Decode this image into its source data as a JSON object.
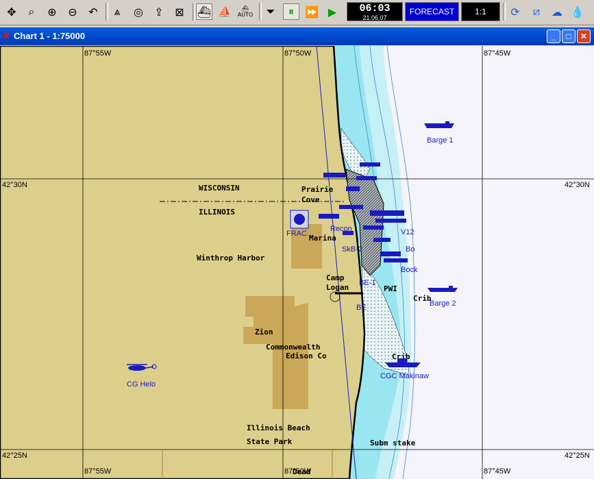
{
  "toolbar": {
    "icons": [
      "zoom-fit-icon",
      "zoom-window-icon",
      "zoom-in-icon",
      "zoom-out-icon",
      "undo-icon",
      "route-icon",
      "target-icon",
      "upload-icon",
      "chart-tool-icon",
      "ship-view-icon",
      "ship-icon",
      "auto-ship-icon",
      "stop-icon",
      "pause-icon",
      "fast-forward-icon",
      "play-icon",
      "satellite-icon",
      "chart-icon",
      "weather-icon",
      "water-drop-icon"
    ],
    "auto_label": "AUTO",
    "clock_time": "06:03",
    "clock_date": "21.06.07",
    "forecast_label": "FORECAST",
    "scale_ratio": "1:1"
  },
  "window": {
    "title": "Chart 1 - 1:75000",
    "minimize": "_",
    "maximize": "□",
    "close": "✕"
  },
  "colors": {
    "land": "#dccf8b",
    "deep_water": "#f4f4fa",
    "shallow_water": "#9ae6f0",
    "mid_water": "#c6f0f6",
    "restricted": "#c8a050",
    "objects": "#1a1ac0",
    "titlebar": "#0054e3"
  },
  "coords": {
    "top_left": "87°55W",
    "top_mid": "87°50W",
    "top_right": "87°45W",
    "left_top": "42°30N",
    "right_top": "42°30N",
    "left_bottom": "42°25N",
    "right_bottom": "42°25N",
    "bottom_left": "87°55W",
    "bottom_mid": "87°50W",
    "bottom_right": "87°45W"
  },
  "map_labels": {
    "wisconsin": "WISCONSIN",
    "illinois": "ILLINOIS",
    "prairie": "Prairie",
    "cove": "Cove",
    "marina": "Marina",
    "winthrop": "Winthrop Harbor",
    "camp": "Camp",
    "logan": "Logan",
    "zion": "Zion",
    "commonwealth": "Commonwealth",
    "edison": "Edison Co",
    "crib1": "Crib",
    "crib2": "Crib",
    "illinois_beach": "Illinois Beach",
    "state_park": "State Park",
    "subm_stake": "Subm stake",
    "pwi": "PWI",
    "dead": "Dead"
  },
  "objects": {
    "barge1": "Barge 1",
    "barge2": "Barge 2",
    "cg_helo": "CG Helo",
    "cgc_makinaw": "CGC Makinaw",
    "frac": "FRAC",
    "skb2": "SkB-2",
    "recon": "Recon",
    "be1": "BE-1",
    "be2": "BE",
    "bock": "Bock",
    "bo": "Bo",
    "v12": "V12"
  }
}
